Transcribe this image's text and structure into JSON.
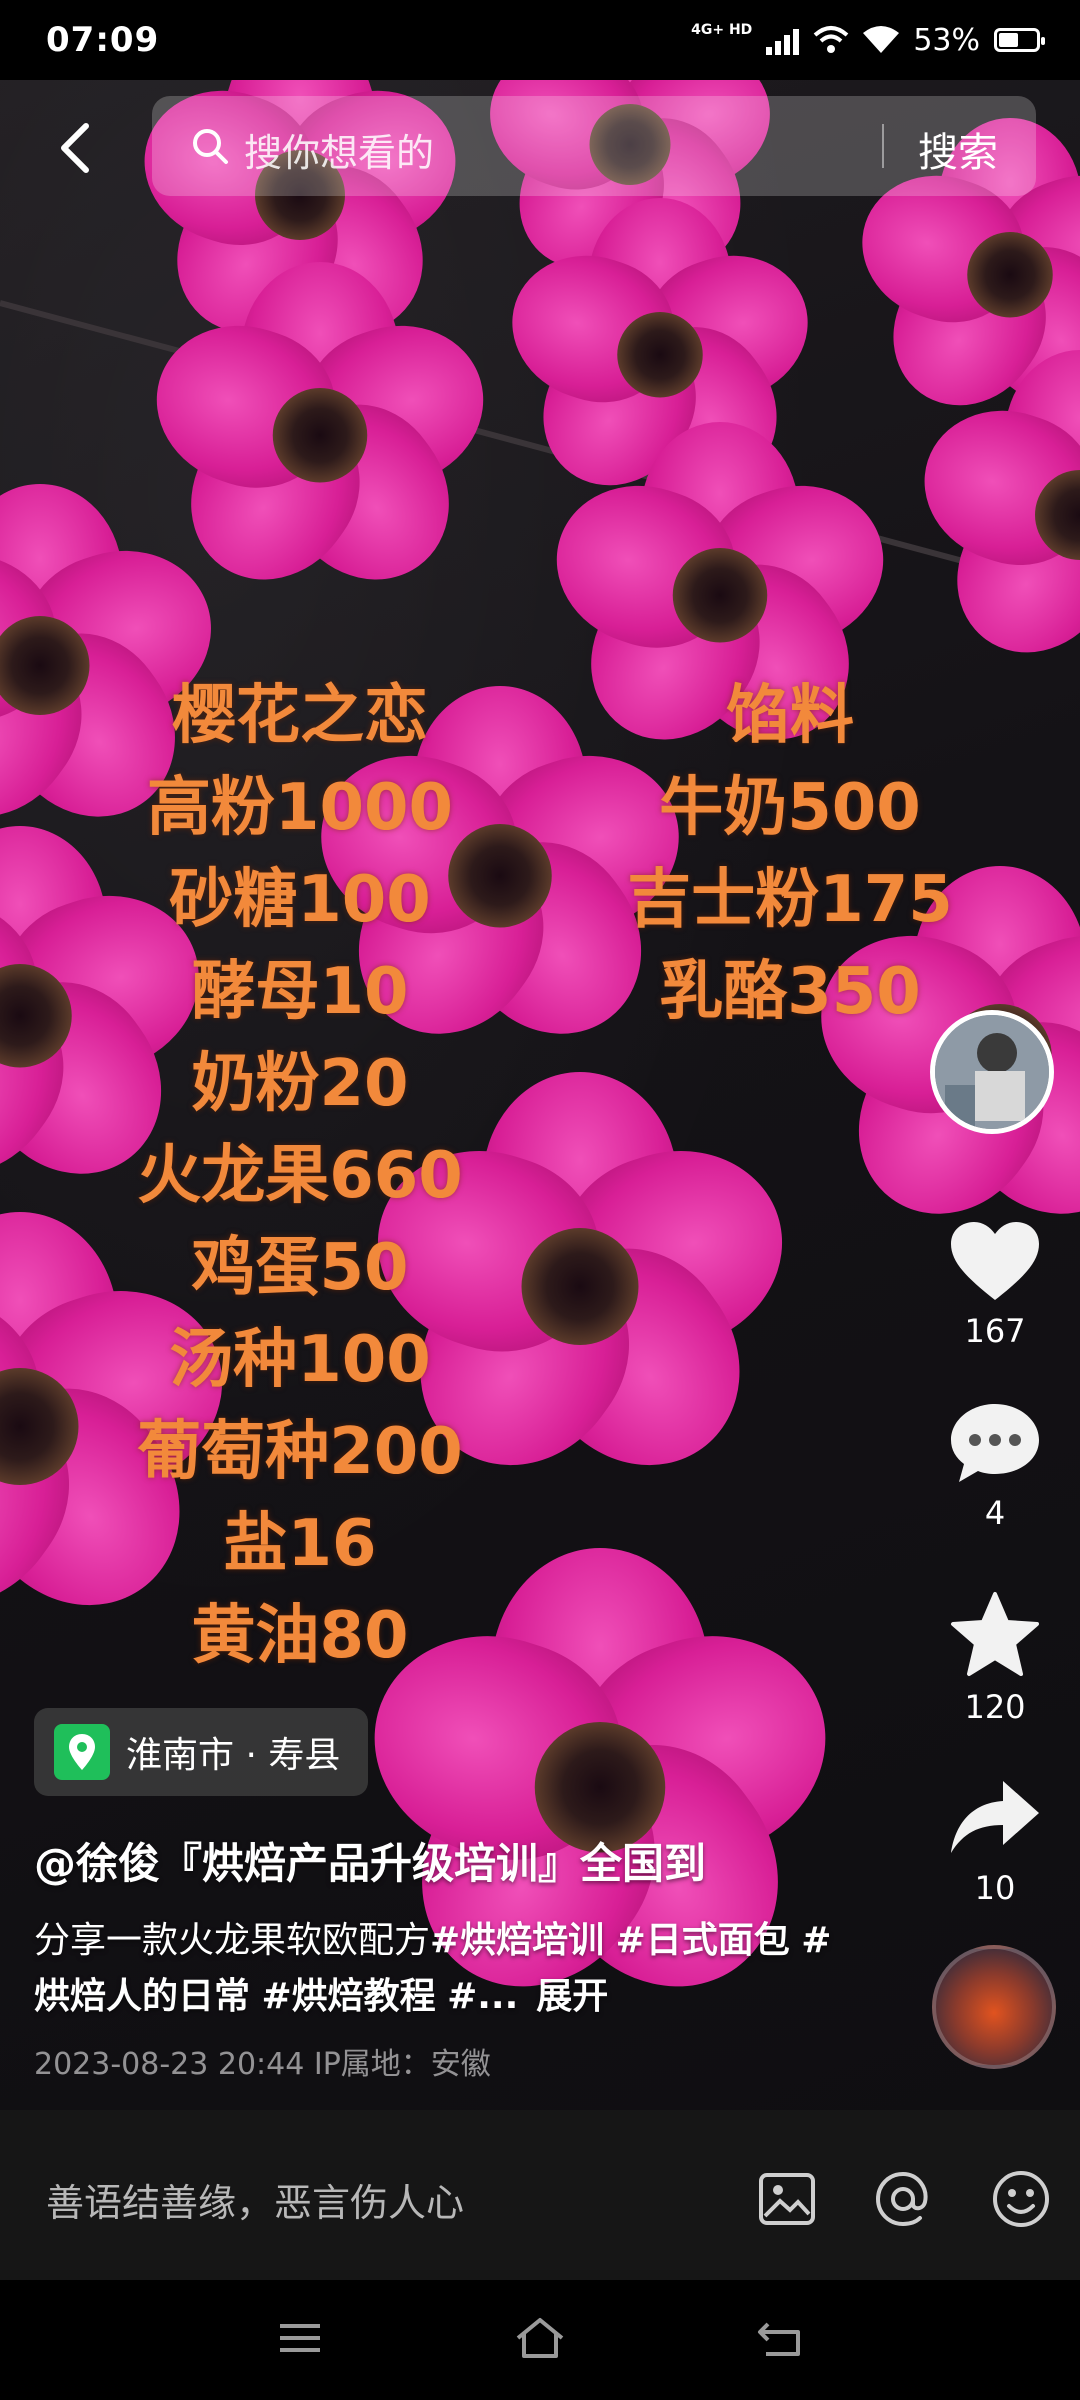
{
  "status_bar": {
    "time": "07:09",
    "network_label": "4G+ HD",
    "battery_percent": "53%",
    "battery_level": 0.53
  },
  "search": {
    "placeholder": "搜你想看的",
    "button_label": "搜索"
  },
  "recipe": {
    "left_lines": [
      "樱花之恋",
      "高粉1000",
      "砂糖100",
      "酵母10",
      "奶粉20",
      "火龙果660",
      "鸡蛋50",
      "汤种100",
      "葡萄种200",
      "盐16",
      "黄油80"
    ],
    "right_lines": [
      "馅料",
      "牛奶500",
      "吉士粉175",
      "乳酪350"
    ]
  },
  "side_actions": {
    "likes": "167",
    "comments": "4",
    "favorites": "120",
    "shares": "10"
  },
  "location": "淮南市 · 寿县",
  "caption": {
    "author": "@徐俊『烘焙产品升级培训』全国到",
    "text_prefix": "分享一款火龙果软欧配方",
    "tag1": "#烘焙培训",
    "tag2": "#日式面包",
    "tag3": "#烘焙人的日常",
    "tag4": "#烘焙教程",
    "tag5": "#...",
    "expand": "展开",
    "meta": "2023-08-23 20:44   IP属地：安徽"
  },
  "comment_bar": {
    "placeholder": "善语结善缘，恶言伤人心"
  },
  "colors": {
    "recipe_text": "#f2893b",
    "flower_pink": "#d81f96",
    "location_pin": "#1fbf5a"
  }
}
